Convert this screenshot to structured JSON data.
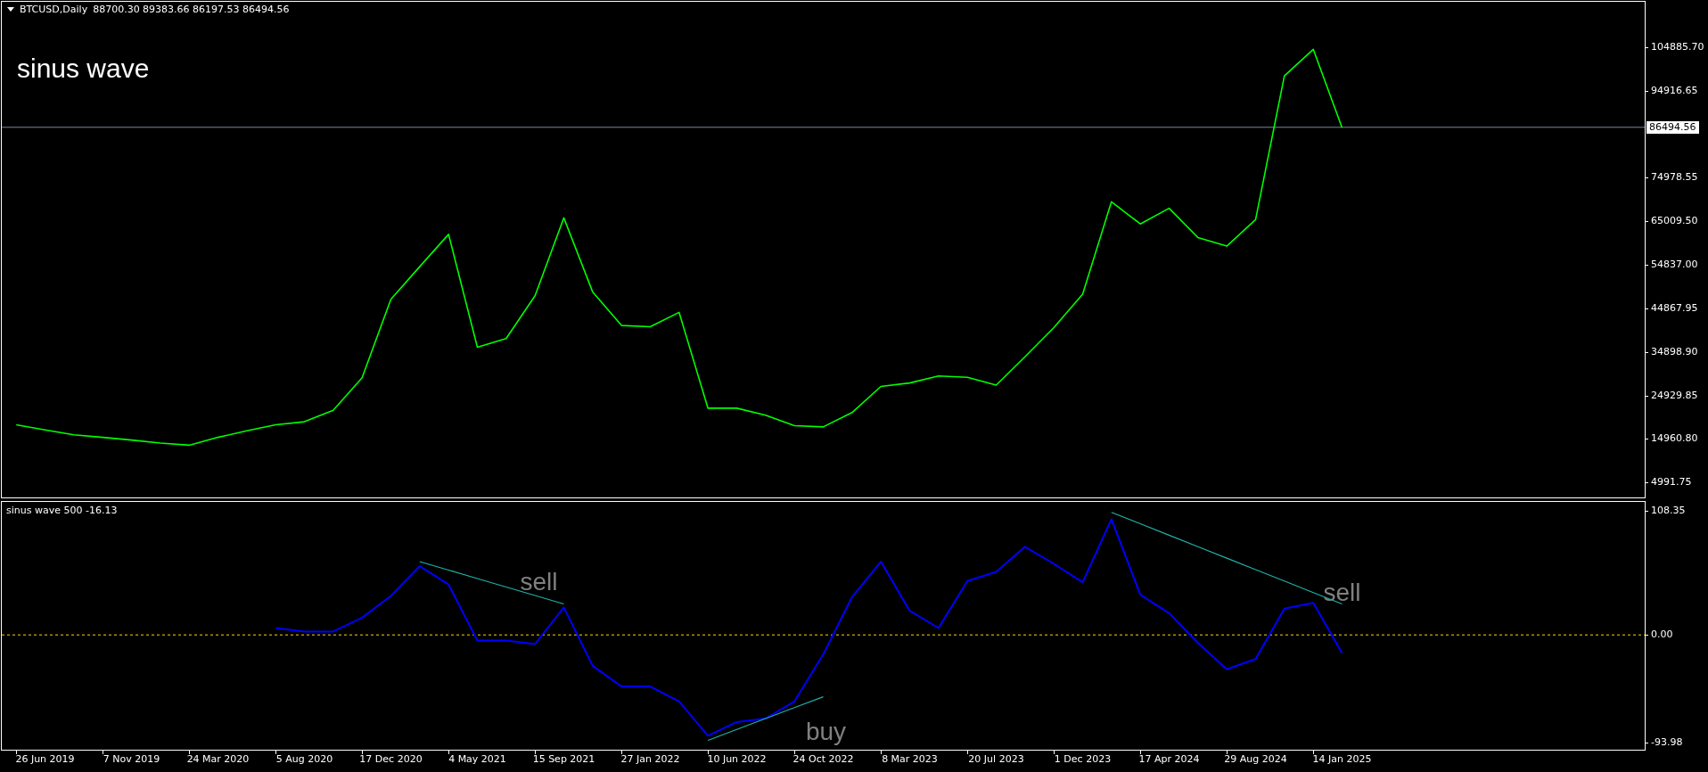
{
  "main_pane": {
    "symbol": "BTCUSD,Daily",
    "ohlc": "88700.30 89383.66 86197.53 86494.56",
    "label": "sinus wave",
    "chart_data": {
      "type": "line",
      "ylim": [
        1515,
        115305
      ],
      "categories": [
        null,
        null,
        null,
        null,
        null,
        null,
        null,
        null,
        null,
        null,
        null,
        null,
        null,
        null,
        null,
        null,
        null,
        null,
        null,
        null,
        null,
        null,
        null,
        null,
        null,
        null,
        null,
        null,
        null,
        null,
        null,
        null,
        null,
        null,
        null,
        null,
        null,
        null,
        null,
        null,
        null,
        null,
        null,
        null,
        null,
        null,
        null,
        null,
        null,
        null,
        null,
        null,
        null,
        null,
        null,
        null,
        null
      ],
      "yticks": [
        {
          "value": 104885.7,
          "label": "104885.70"
        },
        {
          "value": 94916.65,
          "label": "94916.65"
        },
        {
          "value": 74978.55,
          "label": "74978.55"
        },
        {
          "value": 65009.5,
          "label": "65009.50"
        },
        {
          "value": 54837,
          "label": "54837.00"
        },
        {
          "value": 44867.95,
          "label": "44867.95"
        },
        {
          "value": 34898.9,
          "label": "34898.90"
        },
        {
          "value": 24929.85,
          "label": "24929.85"
        },
        {
          "value": 14960.8,
          "label": "14960.80"
        },
        {
          "value": 4991.75,
          "label": "4991.75"
        }
      ],
      "series": [
        {
          "color": "#00ff00",
          "values": [
            18200,
            17000,
            15900,
            15300,
            14700,
            14000,
            13500,
            15300,
            16800,
            18200,
            18900,
            21500,
            29000,
            47000,
            54500,
            61900,
            36000,
            38000,
            47800,
            65700,
            48700,
            41000,
            40700,
            44000,
            22000,
            22000,
            20400,
            18000,
            17700,
            21000,
            27000,
            27800,
            29400,
            29100,
            27300,
            33800,
            40500,
            48200,
            69400,
            64300,
            67900,
            61200,
            59200,
            65300,
            98300,
            104400,
            86400,
            null,
            null,
            null,
            null,
            null,
            null,
            null,
            null,
            null,
            null
          ]
        }
      ],
      "ref_lines": [
        {
          "axis": "y",
          "value": 86494.56,
          "label": "86494.56"
        }
      ]
    }
  },
  "indicator_pane": {
    "title": "sinus wave 500 -16.13",
    "chart_data": {
      "type": "line",
      "ylim": [
        -100.2,
        116.1
      ],
      "categories": [
        null,
        "26 Jun 2019",
        null,
        null,
        "7 Nov 2019",
        null,
        null,
        "24 Mar 2020",
        null,
        null,
        "5 Aug 2020",
        null,
        null,
        "17 Dec 2020",
        null,
        null,
        "4 May 2021",
        null,
        null,
        "15 Sep 2021",
        null,
        null,
        "27 Jan 2022",
        null,
        null,
        "10 Jun 2022",
        null,
        null,
        "24 Oct 2022",
        null,
        null,
        "8 Mar 2023",
        null,
        null,
        "20 Jul 2023",
        null,
        null,
        "1 Dec 2023",
        null,
        null,
        "17 Apr 2024",
        null,
        null,
        "29 Aug 2024",
        null,
        null,
        "14 Jan 2025",
        null,
        null,
        null,
        null,
        null,
        null,
        null,
        null,
        null,
        null
      ],
      "yticks": [
        {
          "value": 108.35,
          "label": "108.35"
        },
        {
          "value": 0,
          "label": "0.00"
        },
        {
          "value": -93.98,
          "label": "-93.98"
        }
      ],
      "series": [
        {
          "color": "#0000ff",
          "values": [
            null,
            null,
            null,
            null,
            null,
            null,
            null,
            null,
            null,
            6,
            3,
            3,
            15,
            34,
            60,
            44,
            -5,
            -5,
            -8,
            24,
            -27,
            -45,
            -45,
            -58,
            -88,
            -76,
            -73,
            -58,
            -17,
            33,
            64,
            21,
            6,
            47,
            55,
            77,
            62,
            46,
            101,
            35,
            19,
            -7,
            -30,
            -21,
            23,
            28,
            -16,
            null,
            null,
            null,
            null,
            null,
            null,
            null,
            null,
            null,
            null
          ]
        },
        {
          "color": "#20b2aa",
          "values": [
            null,
            null,
            null,
            null,
            null,
            null,
            null,
            null,
            null,
            null,
            null,
            null,
            null,
            null,
            64,
            56.6,
            49.2,
            41.8,
            34.4,
            27,
            null,
            null,
            null,
            null,
            null,
            null,
            null,
            null,
            null,
            null,
            null,
            null,
            null,
            null,
            null,
            null,
            null,
            null,
            null,
            null,
            null,
            null,
            null,
            null,
            null,
            null,
            null,
            null,
            null,
            null,
            null,
            null,
            null,
            null,
            null,
            null,
            null
          ]
        },
        {
          "color": "#20b2aa",
          "values": [
            null,
            null,
            null,
            null,
            null,
            null,
            null,
            null,
            null,
            null,
            null,
            null,
            null,
            null,
            null,
            null,
            null,
            null,
            null,
            null,
            null,
            null,
            null,
            null,
            -92,
            -82.5,
            -73,
            -63.5,
            -54,
            null,
            null,
            null,
            null,
            null,
            null,
            null,
            null,
            null,
            null,
            null,
            null,
            null,
            null,
            null,
            null,
            null,
            null,
            null,
            null,
            null,
            null,
            null,
            null,
            null,
            null,
            null,
            null
          ]
        },
        {
          "color": "#20b2aa",
          "values": [
            null,
            null,
            null,
            null,
            null,
            null,
            null,
            null,
            null,
            null,
            null,
            null,
            null,
            null,
            null,
            null,
            null,
            null,
            null,
            null,
            null,
            null,
            null,
            null,
            null,
            null,
            null,
            null,
            null,
            null,
            null,
            null,
            null,
            null,
            null,
            null,
            null,
            null,
            107,
            97,
            87,
            77,
            67,
            57,
            47,
            37,
            27,
            null,
            null,
            null,
            null,
            null,
            null,
            null,
            null,
            null,
            null
          ]
        }
      ],
      "ref_lines": [
        {
          "axis": "y",
          "value": 0
        }
      ],
      "annotations": [
        "sell",
        "buy",
        "sell"
      ]
    }
  }
}
